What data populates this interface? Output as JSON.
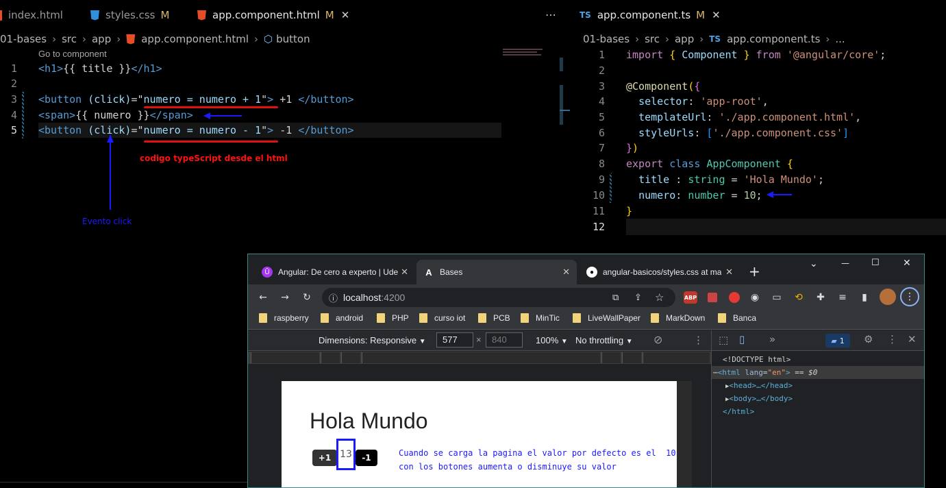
{
  "editor_left": {
    "tabs": [
      {
        "name": "index.html",
        "type": "html",
        "modified": ""
      },
      {
        "name": "styles.css",
        "type": "css",
        "modified": "M"
      },
      {
        "name": "app.component.html",
        "type": "html",
        "modified": "M"
      }
    ],
    "breadcrumb": [
      "01-bases",
      "src",
      "app",
      "app.component.html",
      "button"
    ],
    "codelens": "Go to component",
    "line_numbers": [
      "1",
      "2",
      "3",
      "4",
      "5"
    ],
    "code": {
      "l1_open": "<h1>",
      "l1_expr": "{{ title }}",
      "l1_close": "</h1>",
      "l3_open": "<button",
      "l3_event": "(click)",
      "l3_eq": "=\"",
      "l3_stmt": "numero = numero + 1",
      "l3_q": "\"",
      "l3_gt": ">",
      "l3_text": " +1 ",
      "l3_close": "</button>",
      "l4_open": "<span>",
      "l4_expr": "{{ numero }}",
      "l4_close": "</span>",
      "l5_open": "<button",
      "l5_event": "(click)",
      "l5_eq": "=\"",
      "l5_stmt": "numero = numero - 1",
      "l5_q": "\"",
      "l5_gt": ">",
      "l5_text": " -1 ",
      "l5_close": "</button>"
    },
    "annotations": {
      "red": "codigo typeScript desde  el html",
      "blue": "Evento  click"
    }
  },
  "editor_right": {
    "tab": {
      "name": "app.component.ts",
      "type": "ts",
      "modified": "M"
    },
    "more_icon": "⋯",
    "breadcrumb": [
      "01-bases",
      "src",
      "app",
      "app.component.ts",
      "..."
    ],
    "line_numbers": [
      "1",
      "2",
      "3",
      "4",
      "5",
      "6",
      "7",
      "8",
      "9",
      "10",
      "11",
      "12"
    ],
    "code": {
      "l1_import": "import",
      "l1_b1": "{ ",
      "l1_comp": "Component",
      "l1_b2": " }",
      "l1_from": " from ",
      "l1_str": "'@angular/core'",
      "l1_semi": ";",
      "l3_at": "@",
      "l3_dec": "Component",
      "l3_p": "(",
      "l3_b": "{",
      "l4_key": "selector",
      "l4_colon": ": ",
      "l4_str": "'app-root'",
      "l4_comma": ",",
      "l5_key": "templateUrl",
      "l5_colon": ": ",
      "l5_str": "'./app.component.html'",
      "l5_comma": ",",
      "l6_key": "styleUrls",
      "l6_colon": ": ",
      "l6_b1": "[",
      "l6_str": "'./app.component.css'",
      "l6_b2": "]",
      "l7_b": "}",
      "l7_p": ")",
      "l8_export": "export",
      "l8_class": "class",
      "l8_name": "AppComponent",
      "l8_b": "{",
      "l9_key": "title",
      "l9_colon": " : ",
      "l9_type": "string",
      "l9_eq": " = ",
      "l9_str": "'Hola Mundo'",
      "l9_semi": ";",
      "l10_key": "numero",
      "l10_colon": ": ",
      "l10_type": "number",
      "l10_eq": " = ",
      "l10_num": "10",
      "l10_semi": ";",
      "l11_b": "}"
    }
  },
  "browser": {
    "tabs": [
      {
        "title": "Angular: De cero a experto | Ude",
        "favicon": "udemy-icon"
      },
      {
        "title": "Bases",
        "favicon": "angular-icon"
      },
      {
        "title": "angular-basicos/styles.css at ma",
        "favicon": "github-icon"
      }
    ],
    "new_tab": "+",
    "window_controls": {
      "dropdown": "⌄",
      "minimize": "—",
      "maximize": "☐",
      "close": "✕"
    },
    "url_host": "localhost",
    "url_port": ":4200",
    "bookmarks": [
      "raspberry",
      "android",
      "PHP",
      "curso iot",
      "PCB",
      "MinTic",
      "LiveWallPaper",
      "MarkDown",
      "Banca"
    ],
    "extensions": {
      "abp": "ABP"
    },
    "devices_toolbar": {
      "dimensions_label": "Dimensions: Responsive",
      "width": "577",
      "times": "×",
      "height": "840",
      "zoom": "100%",
      "throttling": "No throttling"
    },
    "devtools": {
      "badge_count": "1",
      "more_tabs": "»",
      "dom": {
        "doctype": "<!DOCTYPE html>",
        "html_open": "<html",
        "lang_attr": "lang",
        "lang_val": "\"en\"",
        "html_gt": ">",
        "eq_sel": " == ",
        "sel_ref": "$0",
        "head": "<head>…</head>",
        "body": "<body>…</body>",
        "html_close": "</html>"
      }
    },
    "page": {
      "title": "Hola Mundo",
      "plus_label": "+1",
      "counter": "13",
      "minus_label": "-1",
      "note_line1": "Cuando se carga la pagina el valor por defecto es el  10",
      "note_line2": "con los botones aumenta o disminuye su valor"
    }
  }
}
